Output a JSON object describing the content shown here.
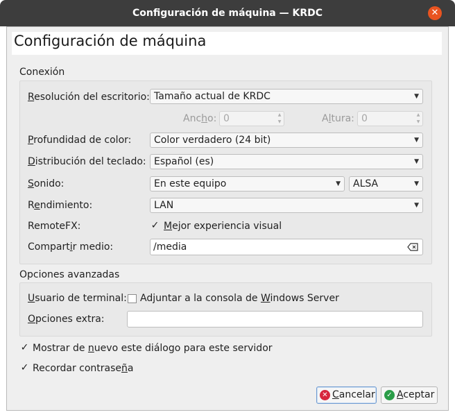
{
  "window": {
    "title": "Configuración de máquina — KRDC"
  },
  "header": {
    "title": "Configuración de máquina"
  },
  "connection": {
    "section_label": "Conexión",
    "resolution": {
      "label_pre": "",
      "label_u": "R",
      "label_post": "esolución del escritorio:",
      "value": "Tamaño actual de KRDC"
    },
    "width": {
      "label_pre": "Anc",
      "label_u": "h",
      "label_post": "o:",
      "value": "0"
    },
    "height": {
      "label_pre": "A",
      "label_u": "l",
      "label_post": "tura:",
      "value": "0"
    },
    "color_depth": {
      "label_pre": "",
      "label_u": "P",
      "label_post": "rofundidad de color:",
      "value": "Color verdadero (24 bit)"
    },
    "keyboard": {
      "label_pre": "",
      "label_u": "D",
      "label_post": "istribución del teclado:",
      "value": "Español (es)"
    },
    "sound": {
      "label_pre": "",
      "label_u": "S",
      "label_post": "onido:",
      "value": "En este equipo",
      "backend": "ALSA"
    },
    "performance": {
      "label_pre": "R",
      "label_u": "e",
      "label_post": "ndimiento:",
      "value": "LAN"
    },
    "remotefx": {
      "label": "RemoteFX:",
      "check_pre": "",
      "check_u": "M",
      "check_post": "ejor experiencia visual",
      "checked": "✓"
    },
    "share_media": {
      "label_pre": "Compart",
      "label_u": "i",
      "label_post": "r medio:",
      "value": "/media"
    }
  },
  "advanced": {
    "section_label": "Opciones avanzadas",
    "terminal_user": {
      "label_pre": "",
      "label_u": "U",
      "label_post": "suario de terminal:",
      "check_pre": "Adjuntar a la consola de ",
      "check_u": "W",
      "check_post": "indows Server"
    },
    "extra": {
      "label_pre": "",
      "label_u": "O",
      "label_post": "pciones extra:",
      "value": ""
    }
  },
  "show_dialog": {
    "pre": "Mostrar de ",
    "u": "n",
    "post": "uevo este diálogo para este servidor",
    "checked": "✓"
  },
  "remember_pw": {
    "pre": "Recordar contrase",
    "u": "ñ",
    "post": "a",
    "checked": "✓"
  },
  "buttons": {
    "cancel": {
      "u": "C",
      "post": "ancelar",
      "icon": "✕"
    },
    "accept": {
      "u": "A",
      "post": "ceptar",
      "icon": "✓"
    }
  },
  "colors": {
    "titlebar": "#3d3d3d",
    "close": "#e95420",
    "cancel_icon": "#d7263d",
    "accept_icon": "#2a9d48"
  }
}
